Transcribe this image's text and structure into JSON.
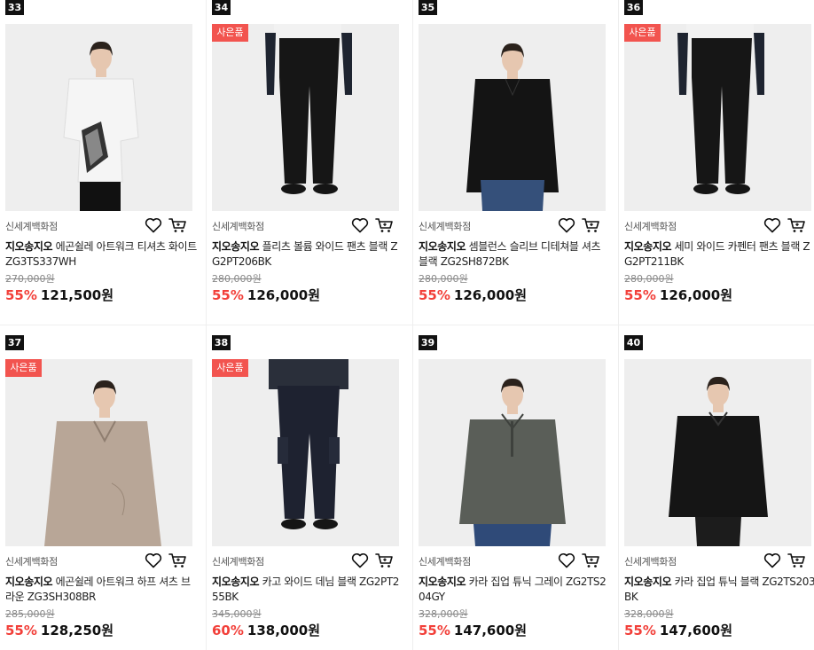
{
  "products": [
    {
      "rank": "33",
      "badge": "",
      "store": "신세계백화점",
      "brand": "지오송지오",
      "name": "에곤쉴레 아트워크 티셔츠 화이트 ZG3TS337WH",
      "original_price": "270,000원",
      "discount": "55%",
      "price": "121,500원",
      "garment": "white-shirt"
    },
    {
      "rank": "34",
      "badge": "사은품",
      "store": "신세계백화점",
      "brand": "지오송지오",
      "name": "플리츠 볼륨 와이드 팬츠 블랙 ZG2PT206BK",
      "original_price": "280,000원",
      "discount": "55%",
      "price": "126,000원",
      "garment": "black-pants"
    },
    {
      "rank": "35",
      "badge": "",
      "store": "신세계백화점",
      "brand": "지오송지오",
      "name": "셈블런스 슬리브 디테쳐블 셔츠 블랙 ZG2SH872BK",
      "original_price": "280,000원",
      "discount": "55%",
      "price": "126,000원",
      "garment": "black-shirt"
    },
    {
      "rank": "36",
      "badge": "사은품",
      "store": "신세계백화점",
      "brand": "지오송지오",
      "name": "세미 와이드 카펜터 팬츠 블랙 ZG2PT211BK",
      "original_price": "280,000원",
      "discount": "55%",
      "price": "126,000원",
      "garment": "black-pants"
    },
    {
      "rank": "37",
      "badge": "사은품",
      "store": "신세계백화점",
      "brand": "지오송지오",
      "name": "에곤쉴레 아트워크 하프 셔츠 브라운 ZG3SH308BR",
      "original_price": "285,000원",
      "discount": "55%",
      "price": "128,250원",
      "garment": "beige-shirt"
    },
    {
      "rank": "38",
      "badge": "사은품",
      "store": "신세계백화점",
      "brand": "지오송지오",
      "name": "카고 와이드 데님 블랙 ZG2PT255BK",
      "original_price": "345,000원",
      "discount": "60%",
      "price": "138,000원",
      "garment": "denim-pants"
    },
    {
      "rank": "39",
      "badge": "",
      "store": "신세계백화점",
      "brand": "지오송지오",
      "name": "카라 집업 튜닉 그레이 ZG2TS204GY",
      "original_price": "328,000원",
      "discount": "55%",
      "price": "147,600원",
      "garment": "gray-tunic"
    },
    {
      "rank": "40",
      "badge": "",
      "store": "신세계백화점",
      "brand": "지오송지오",
      "name": "카라 집업 튜닉 블랙 ZG2TS203BK",
      "original_price": "328,000원",
      "discount": "55%",
      "price": "147,600원",
      "garment": "black-tunic"
    }
  ],
  "icons": {
    "wishlist": "heart-outline-icon",
    "cart": "shopping-cart-icon"
  },
  "colors": {
    "discount": "#f2403a",
    "badge": "#f2544f",
    "rank_bg": "#111111",
    "photo_bg": "#eeeeee"
  }
}
